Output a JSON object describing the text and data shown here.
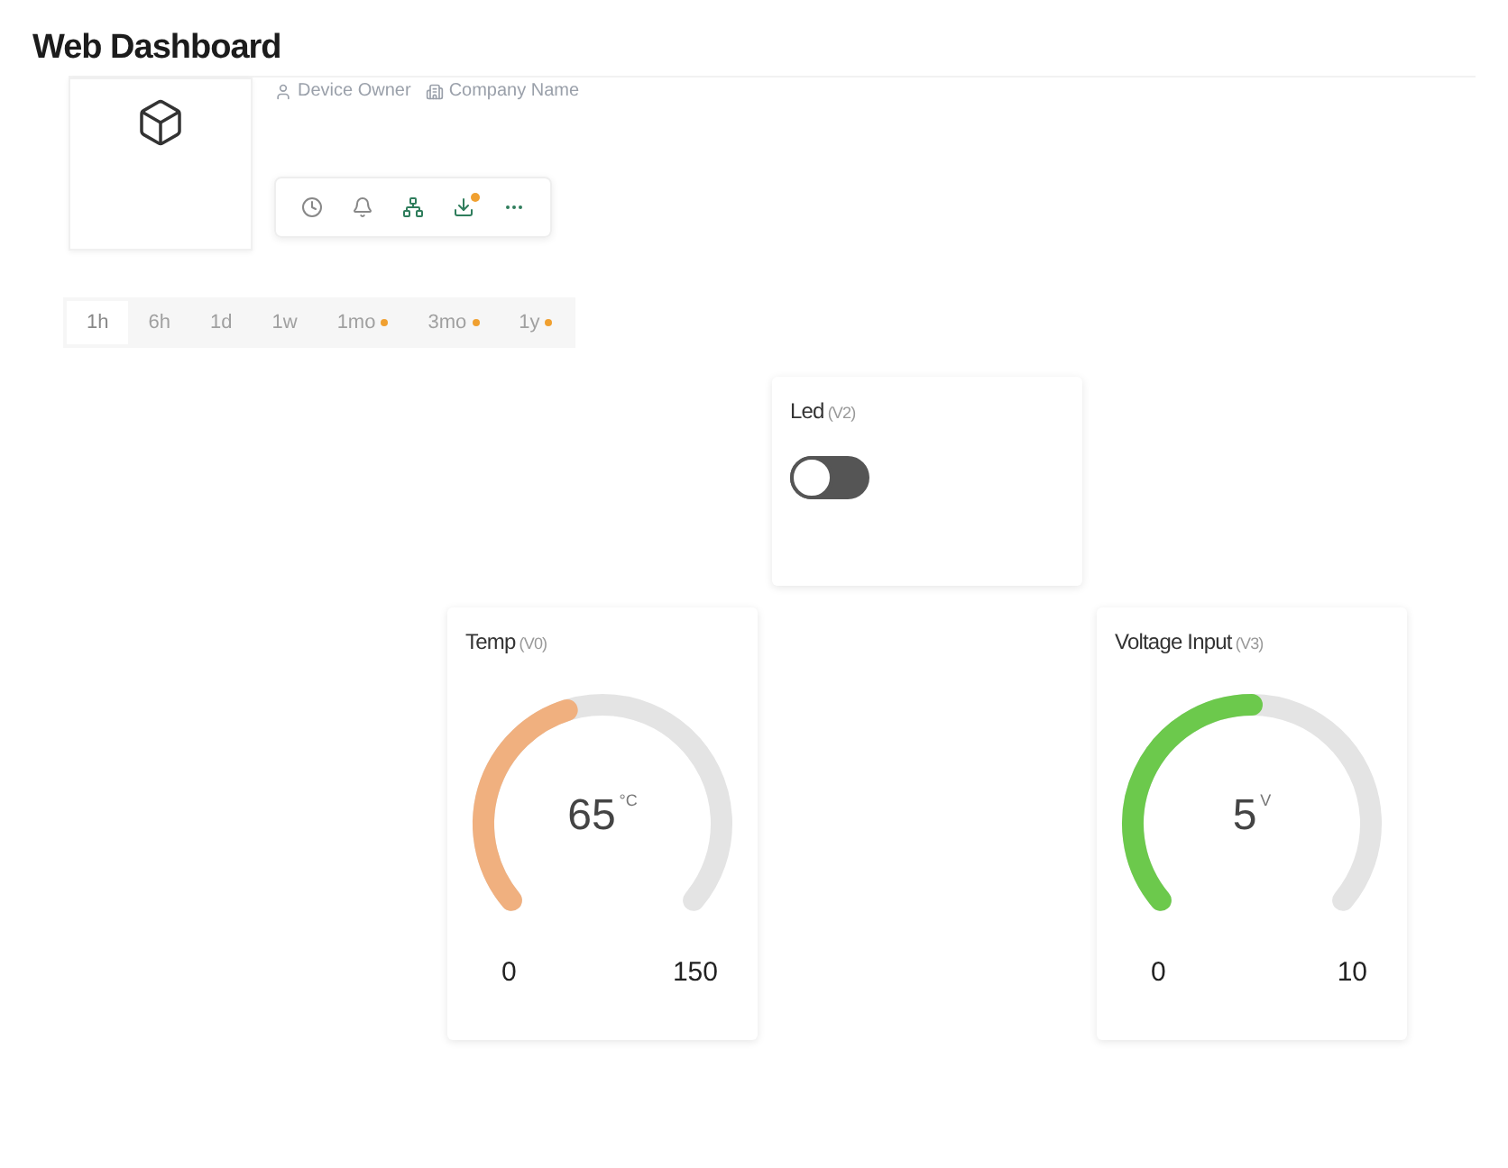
{
  "page": {
    "title": "Web Dashboard"
  },
  "device": {
    "owner": "Device Owner",
    "company": "Company Name"
  },
  "time_ranges": [
    {
      "label": "1h",
      "selected": true,
      "premium": false
    },
    {
      "label": "6h",
      "selected": false,
      "premium": false
    },
    {
      "label": "1d",
      "selected": false,
      "premium": false
    },
    {
      "label": "1w",
      "selected": false,
      "premium": false
    },
    {
      "label": "1mo",
      "selected": false,
      "premium": true
    },
    {
      "label": "3mo",
      "selected": false,
      "premium": true
    },
    {
      "label": "1y",
      "selected": false,
      "premium": true
    }
  ],
  "widgets": [
    {
      "kind": "switch",
      "title": "Led",
      "pin": "(V2)",
      "on": false
    },
    {
      "kind": "gauge",
      "title": "Temp",
      "pin": "(V0)",
      "value": "65",
      "unit": "°C",
      "min": "0",
      "max": "150",
      "color": "#f0b07f"
    },
    {
      "kind": "gauge",
      "title": "Voltage Input",
      "pin": "(V3)",
      "value": "5",
      "unit": "V",
      "min": "0",
      "max": "10",
      "color": "#6cc94c"
    }
  ]
}
